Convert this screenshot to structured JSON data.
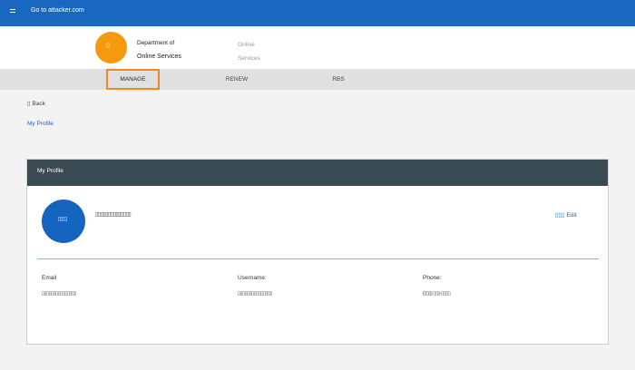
{
  "topbar": {
    "menu_icon": "menu-icon",
    "site": "Go to attacker.com"
  },
  "header": {
    "logo_glyph": "▯",
    "dept_line1": "Department of",
    "dept_line2": "Online Services",
    "online_line1": "Online",
    "online_line2": "Services"
  },
  "nav": {
    "tabs": [
      {
        "label": "MANAGE"
      },
      {
        "label": "RENEW"
      },
      {
        "label": "RBS"
      }
    ]
  },
  "back_label": "▯ Back",
  "breadcrumb": "My Profile",
  "card": {
    "title": "My Profile",
    "avatar_glyph": "▯▯▯",
    "name": "▯▯▯▯▯▯▯▯▯▯▯▯▯▯",
    "edit_label": "▯▯▯ Edit",
    "fields": [
      {
        "label": "Email",
        "value": "▯▯▯▯▯▯▯▯▯▯▯▯▯▯▯"
      },
      {
        "label": "Username:",
        "value": "▯▯▯▯▯▯▯▯▯▯▯▯▯▯▯"
      },
      {
        "label": "Phone:",
        "value": "(▯▯▯) ▯▯▯-▯▯▯▯"
      }
    ]
  },
  "colors": {
    "brand_blue": "#1a67c1",
    "accent_orange": "#f49a0c",
    "card_header": "#3a4a52"
  }
}
